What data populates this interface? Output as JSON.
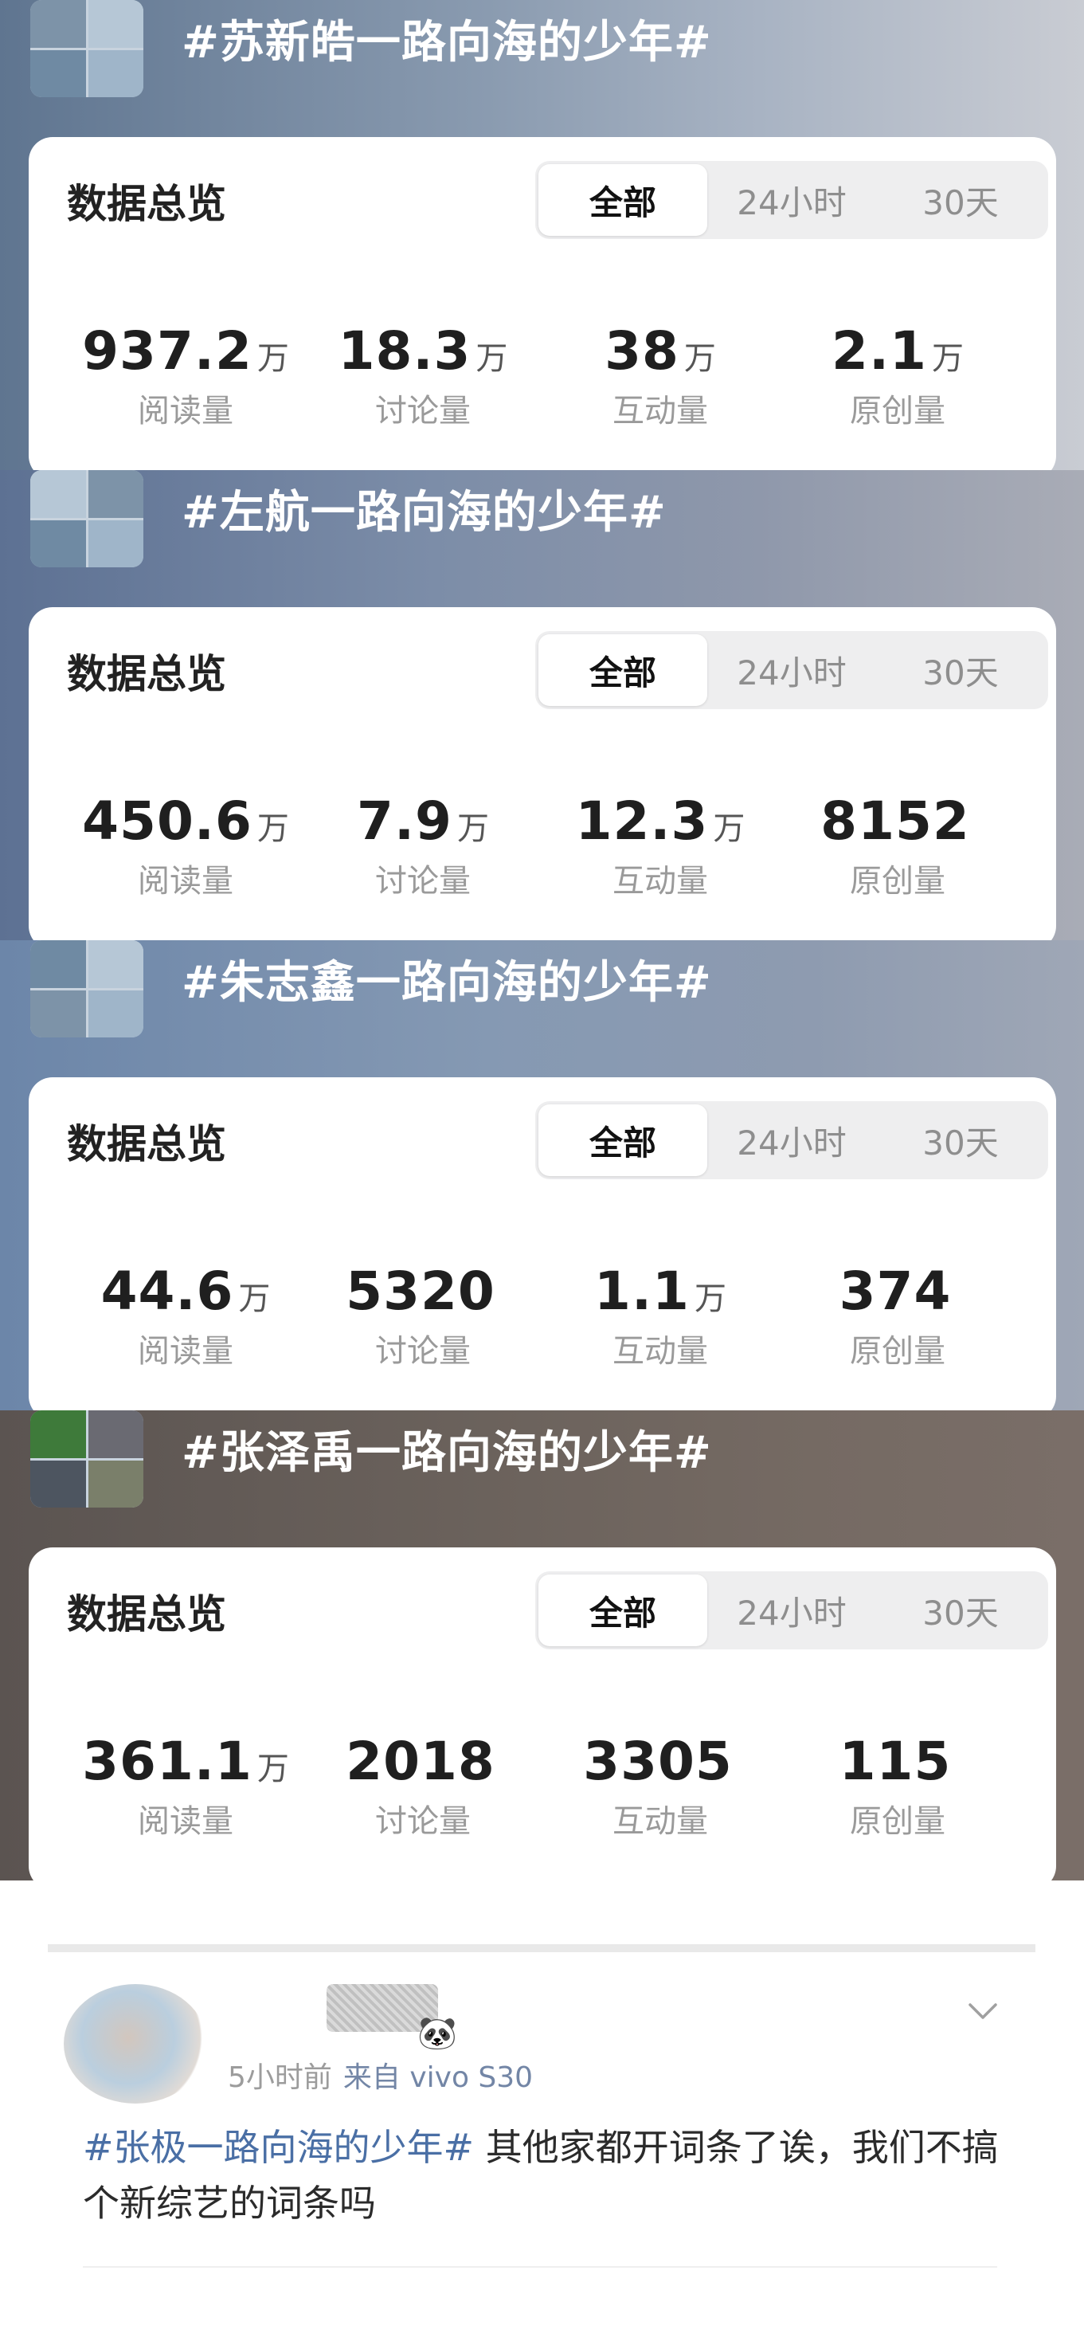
{
  "sections": [
    {
      "topic": "#苏新皓一路向海的少年#",
      "card_title": "数据总览",
      "tabs": [
        "全部",
        "24小时",
        "30天"
      ],
      "stats": [
        {
          "value": "937.2",
          "unit": "万",
          "label": "阅读量"
        },
        {
          "value": "18.3",
          "unit": "万",
          "label": "讨论量"
        },
        {
          "value": "38",
          "unit": "万",
          "label": "互动量"
        },
        {
          "value": "2.1",
          "unit": "万",
          "label": "原创量"
        }
      ]
    },
    {
      "topic": "#左航一路向海的少年#",
      "card_title": "数据总览",
      "tabs": [
        "全部",
        "24小时",
        "30天"
      ],
      "stats": [
        {
          "value": "450.6",
          "unit": "万",
          "label": "阅读量"
        },
        {
          "value": "7.9",
          "unit": "万",
          "label": "讨论量"
        },
        {
          "value": "12.3",
          "unit": "万",
          "label": "互动量"
        },
        {
          "value": "8152",
          "unit": "",
          "label": "原创量"
        }
      ]
    },
    {
      "topic": "#朱志鑫一路向海的少年#",
      "card_title": "数据总览",
      "tabs": [
        "全部",
        "24小时",
        "30天"
      ],
      "stats": [
        {
          "value": "44.6",
          "unit": "万",
          "label": "阅读量"
        },
        {
          "value": "5320",
          "unit": "",
          "label": "讨论量"
        },
        {
          "value": "1.1",
          "unit": "万",
          "label": "互动量"
        },
        {
          "value": "374",
          "unit": "",
          "label": "原创量"
        }
      ]
    },
    {
      "topic": "#张泽禹一路向海的少年#",
      "card_title": "数据总览",
      "tabs": [
        "全部",
        "24小时",
        "30天"
      ],
      "stats": [
        {
          "value": "361.1",
          "unit": "万",
          "label": "阅读量"
        },
        {
          "value": "2018",
          "unit": "",
          "label": "讨论量"
        },
        {
          "value": "3305",
          "unit": "",
          "label": "互动量"
        },
        {
          "value": "115",
          "unit": "",
          "label": "原创量"
        }
      ]
    }
  ],
  "post": {
    "emoji": "🐼",
    "time": "5小时前",
    "source": "来自 vivo S30",
    "hashtag": "#张极一路向海的少年#",
    "text": " 其他家都开词条了诶，我们不搞个新综艺的词条吗"
  }
}
